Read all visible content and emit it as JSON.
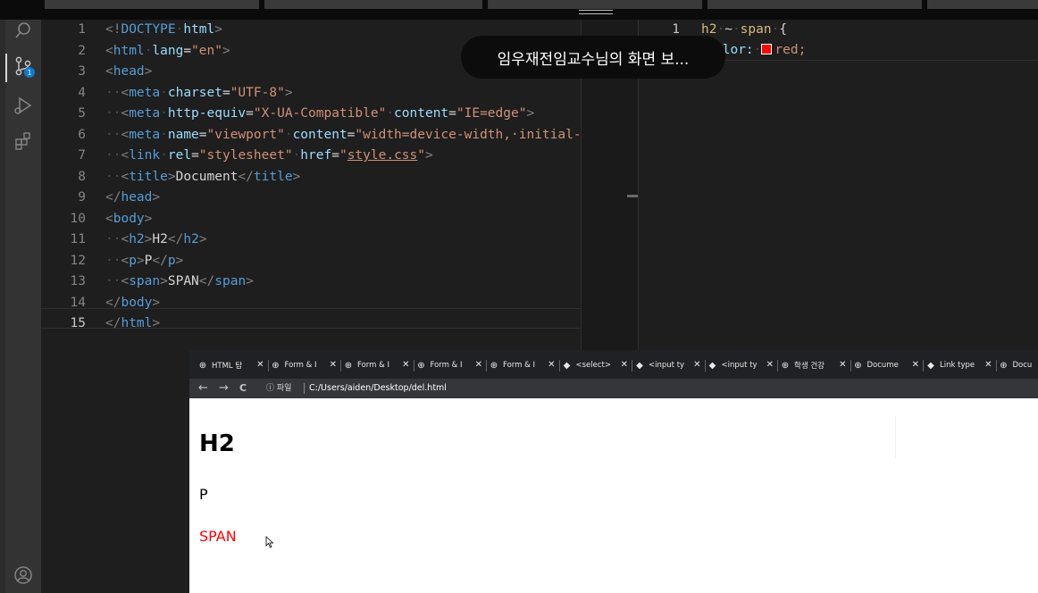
{
  "overlay": {
    "screen_share_notice": "임우재전임교수님의 화면 보..."
  },
  "editor_html": {
    "lines": [
      {
        "num": "1",
        "tokens": [
          {
            "t": "<!",
            "c": "t-punc"
          },
          {
            "t": "DOCTYPE",
            "c": "t-tag"
          },
          {
            "t": "·",
            "c": "t-ws"
          },
          {
            "t": "html",
            "c": "t-attr"
          },
          {
            "t": ">",
            "c": "t-punc"
          }
        ]
      },
      {
        "num": "2",
        "tokens": [
          {
            "t": "<",
            "c": "t-punc"
          },
          {
            "t": "html",
            "c": "t-tag"
          },
          {
            "t": "·",
            "c": "t-ws"
          },
          {
            "t": "lang",
            "c": "t-attr"
          },
          {
            "t": "=",
            "c": "t-text"
          },
          {
            "t": "\"en\"",
            "c": "t-str"
          },
          {
            "t": ">",
            "c": "t-punc"
          }
        ]
      },
      {
        "num": "3",
        "tokens": [
          {
            "t": "<",
            "c": "t-punc"
          },
          {
            "t": "head",
            "c": "t-tag"
          },
          {
            "t": ">",
            "c": "t-punc"
          }
        ]
      },
      {
        "num": "4",
        "tokens": [
          {
            "t": "··",
            "c": "t-ws"
          },
          {
            "t": "<",
            "c": "t-punc"
          },
          {
            "t": "meta",
            "c": "t-tag"
          },
          {
            "t": "·",
            "c": "t-ws"
          },
          {
            "t": "charset",
            "c": "t-attr"
          },
          {
            "t": "=",
            "c": "t-text"
          },
          {
            "t": "\"UTF-8\"",
            "c": "t-str"
          },
          {
            "t": ">",
            "c": "t-punc"
          }
        ]
      },
      {
        "num": "5",
        "tokens": [
          {
            "t": "··",
            "c": "t-ws"
          },
          {
            "t": "<",
            "c": "t-punc"
          },
          {
            "t": "meta",
            "c": "t-tag"
          },
          {
            "t": "·",
            "c": "t-ws"
          },
          {
            "t": "http-equiv",
            "c": "t-attr"
          },
          {
            "t": "=",
            "c": "t-text"
          },
          {
            "t": "\"X-UA-Compatible\"",
            "c": "t-str"
          },
          {
            "t": "·",
            "c": "t-ws"
          },
          {
            "t": "content",
            "c": "t-attr"
          },
          {
            "t": "=",
            "c": "t-text"
          },
          {
            "t": "\"IE=edge\"",
            "c": "t-str"
          },
          {
            "t": ">",
            "c": "t-punc"
          }
        ]
      },
      {
        "num": "6",
        "tokens": [
          {
            "t": "··",
            "c": "t-ws"
          },
          {
            "t": "<",
            "c": "t-punc"
          },
          {
            "t": "meta",
            "c": "t-tag"
          },
          {
            "t": "·",
            "c": "t-ws"
          },
          {
            "t": "name",
            "c": "t-attr"
          },
          {
            "t": "=",
            "c": "t-text"
          },
          {
            "t": "\"viewport\"",
            "c": "t-str"
          },
          {
            "t": "·",
            "c": "t-ws"
          },
          {
            "t": "content",
            "c": "t-attr"
          },
          {
            "t": "=",
            "c": "t-text"
          },
          {
            "t": "\"width=device-width,·initial-s",
            "c": "t-str"
          }
        ]
      },
      {
        "num": "7",
        "tokens": [
          {
            "t": "··",
            "c": "t-ws"
          },
          {
            "t": "<",
            "c": "t-punc"
          },
          {
            "t": "link",
            "c": "t-tag"
          },
          {
            "t": "·",
            "c": "t-ws"
          },
          {
            "t": "rel",
            "c": "t-attr"
          },
          {
            "t": "=",
            "c": "t-text"
          },
          {
            "t": "\"stylesheet\"",
            "c": "t-str"
          },
          {
            "t": "·",
            "c": "t-ws"
          },
          {
            "t": "href",
            "c": "t-attr"
          },
          {
            "t": "=",
            "c": "t-text"
          },
          {
            "t": "\"",
            "c": "t-str"
          },
          {
            "t": "style.css",
            "c": "t-str t-link"
          },
          {
            "t": "\"",
            "c": "t-str"
          },
          {
            "t": ">",
            "c": "t-punc"
          }
        ]
      },
      {
        "num": "8",
        "tokens": [
          {
            "t": "··",
            "c": "t-ws"
          },
          {
            "t": "<",
            "c": "t-punc"
          },
          {
            "t": "title",
            "c": "t-tag"
          },
          {
            "t": ">",
            "c": "t-punc"
          },
          {
            "t": "Document",
            "c": "t-text"
          },
          {
            "t": "</",
            "c": "t-punc"
          },
          {
            "t": "title",
            "c": "t-tag"
          },
          {
            "t": ">",
            "c": "t-punc"
          }
        ]
      },
      {
        "num": "9",
        "tokens": [
          {
            "t": "</",
            "c": "t-punc"
          },
          {
            "t": "head",
            "c": "t-tag"
          },
          {
            "t": ">",
            "c": "t-punc"
          }
        ]
      },
      {
        "num": "10",
        "tokens": [
          {
            "t": "<",
            "c": "t-punc"
          },
          {
            "t": "body",
            "c": "t-tag"
          },
          {
            "t": ">",
            "c": "t-punc"
          }
        ]
      },
      {
        "num": "11",
        "tokens": [
          {
            "t": "··",
            "c": "t-ws"
          },
          {
            "t": "<",
            "c": "t-punc"
          },
          {
            "t": "h2",
            "c": "t-tag"
          },
          {
            "t": ">",
            "c": "t-punc"
          },
          {
            "t": "H2",
            "c": "t-text"
          },
          {
            "t": "</",
            "c": "t-punc"
          },
          {
            "t": "h2",
            "c": "t-tag"
          },
          {
            "t": ">",
            "c": "t-punc"
          }
        ]
      },
      {
        "num": "12",
        "tokens": [
          {
            "t": "··",
            "c": "t-ws"
          },
          {
            "t": "<",
            "c": "t-punc"
          },
          {
            "t": "p",
            "c": "t-tag"
          },
          {
            "t": ">",
            "c": "t-punc"
          },
          {
            "t": "P",
            "c": "t-text"
          },
          {
            "t": "</",
            "c": "t-punc"
          },
          {
            "t": "p",
            "c": "t-tag"
          },
          {
            "t": ">",
            "c": "t-punc"
          }
        ]
      },
      {
        "num": "13",
        "tokens": [
          {
            "t": "··",
            "c": "t-ws"
          },
          {
            "t": "<",
            "c": "t-punc"
          },
          {
            "t": "span",
            "c": "t-tag"
          },
          {
            "t": ">",
            "c": "t-punc"
          },
          {
            "t": "SPAN",
            "c": "t-text"
          },
          {
            "t": "</",
            "c": "t-punc"
          },
          {
            "t": "span",
            "c": "t-tag"
          },
          {
            "t": ">",
            "c": "t-punc"
          }
        ]
      },
      {
        "num": "14",
        "tokens": [
          {
            "t": "</",
            "c": "t-punc"
          },
          {
            "t": "body",
            "c": "t-tag"
          },
          {
            "t": ">",
            "c": "t-punc"
          }
        ]
      },
      {
        "num": "15",
        "current": true,
        "tokens": [
          {
            "t": "</",
            "c": "t-punc"
          },
          {
            "t": "html",
            "c": "t-tag"
          },
          {
            "t": ">",
            "c": "t-punc"
          }
        ]
      }
    ]
  },
  "editor_css": {
    "line1_num": "1",
    "selector": "h2",
    "combinator": "~",
    "selector2": "span",
    "brace_open": "{",
    "prop": "olor:",
    "value": "red;",
    "swatch_color": "#ff0000"
  },
  "browser": {
    "tabs": [
      {
        "icon": "globe-icon",
        "fav": "⊕",
        "label": "HTML 탐"
      },
      {
        "icon": "globe-icon",
        "fav": "⊕",
        "label": "Form & I"
      },
      {
        "icon": "globe-icon",
        "fav": "⊕",
        "label": "Form & I"
      },
      {
        "icon": "globe-icon",
        "fav": "⊕",
        "label": "Form & I"
      },
      {
        "icon": "globe-icon",
        "fav": "⊕",
        "label": "Form & I"
      },
      {
        "icon": "bookmark-icon",
        "fav": "◆",
        "label": "<select>"
      },
      {
        "icon": "bookmark-icon",
        "fav": "◆",
        "label": "<input ty"
      },
      {
        "icon": "bookmark-icon",
        "fav": "◆",
        "label": "<input ty"
      },
      {
        "icon": "globe-icon",
        "fav": "⊕",
        "label": "학생 건강"
      },
      {
        "icon": "globe-icon",
        "fav": "⊕",
        "label": "Docume"
      },
      {
        "icon": "bookmark-icon",
        "fav": "◆",
        "label": "Link type"
      },
      {
        "icon": "globe-icon",
        "fav": "⊕",
        "label": "Docu"
      }
    ],
    "tab_close": "✕",
    "nav": {
      "back": "←",
      "forward": "→",
      "reload": "C"
    },
    "address": {
      "info_label": "ⓘ 파일",
      "url": "C:/Users/aiden/Desktop/del.html"
    },
    "page": {
      "h2": "H2",
      "p": "P",
      "span": "SPAN"
    }
  }
}
